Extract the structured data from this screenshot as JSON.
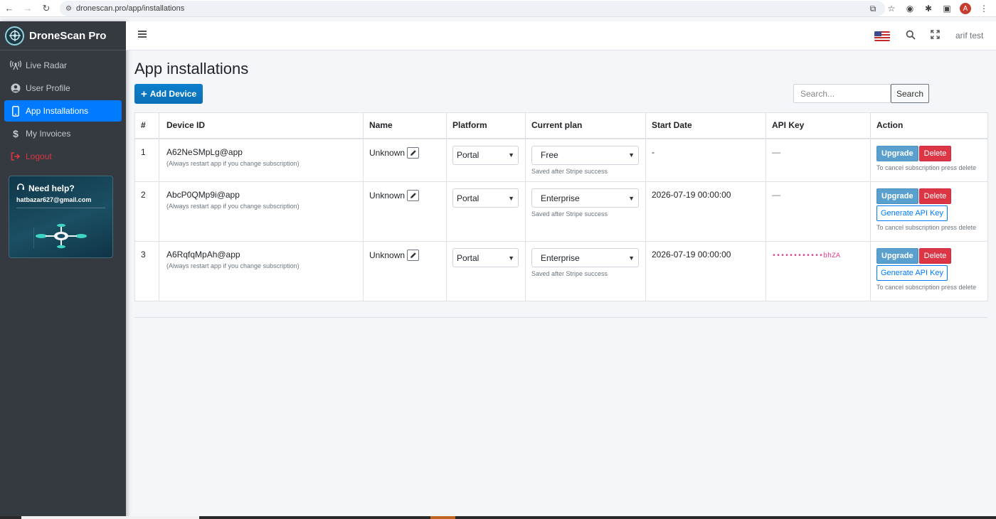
{
  "browser": {
    "url": "dronescan.pro/app/installations",
    "profile_initial": "A"
  },
  "sidebar": {
    "brand": "DroneScan Pro",
    "items": [
      {
        "label": "Live Radar",
        "icon": "radar-icon"
      },
      {
        "label": "User Profile",
        "icon": "user-circle-icon"
      },
      {
        "label": "App Installations",
        "icon": "mobile-icon",
        "active": true
      },
      {
        "label": "My Invoices",
        "icon": "dollar-icon"
      },
      {
        "label": "Logout",
        "icon": "logout-icon"
      }
    ],
    "help": {
      "title": "Need help?",
      "email": "hatbazar627@gmail.com"
    }
  },
  "header": {
    "user_name": "arif test"
  },
  "main": {
    "title": "App installations",
    "add_button": "Add Device",
    "search_placeholder": "Search...",
    "search_button": "Search",
    "table": {
      "columns": [
        "#",
        "Device ID",
        "Name",
        "Platform",
        "Current plan",
        "Start Date",
        "API Key",
        "Action"
      ],
      "rows": [
        {
          "num": "1",
          "device_id": "A62NeSMpLg@app",
          "device_note": "(Always restart app if you change subscription)",
          "name": "Unknown",
          "platform": "Portal",
          "plan": "Free",
          "plan_note": "Saved after Stripe success",
          "start_date": "-",
          "api_key": "—",
          "upgrade": "Upgrade",
          "delete": "Delete",
          "action_note": "To cancel subscription press delete"
        },
        {
          "num": "2",
          "device_id": "AbcP0QMp9i@app",
          "device_note": "(Always restart app if you change subscription)",
          "name": "Unknown",
          "platform": "Portal",
          "plan": "Enterprise",
          "plan_note": "Saved after Stripe success",
          "start_date": "2026-07-19 00:00:00",
          "api_key": "—",
          "upgrade": "Upgrade",
          "delete": "Delete",
          "generate": "Generate API Key",
          "action_note": "To cancel subscription press delete"
        },
        {
          "num": "3",
          "device_id": "A6RqfqMpAh@app",
          "device_note": "(Always restart app if you change subscription)",
          "name": "Unknown",
          "platform": "Portal",
          "plan": "Enterprise",
          "plan_note": "Saved after Stripe success",
          "start_date": "2026-07-19 00:00:00",
          "api_key": "••••••••••••bhZA",
          "upgrade": "Upgrade",
          "delete": "Delete",
          "generate": "Generate API Key",
          "action_note": "To cancel subscription press delete"
        }
      ]
    }
  },
  "colors": {
    "sidebar_bg": "#343a40",
    "active": "#007bff",
    "danger": "#dc3545",
    "api_key": "#e83e8c"
  }
}
